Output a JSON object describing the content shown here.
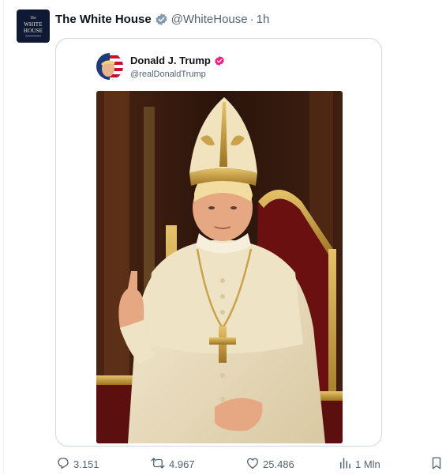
{
  "post": {
    "author_name": "The White House",
    "author_handle": "@WhiteHouse",
    "separator": "·",
    "time": "1h",
    "avatar_text": {
      "the": "The",
      "line1": "WHITE",
      "line2": "HOUSE"
    }
  },
  "quoted": {
    "author_name": "Donald J. Trump",
    "author_handle": "@realDonaldTrump"
  },
  "actions": {
    "replies": "3.151",
    "reposts": "4.967",
    "likes": "25.486",
    "views": "1 Mln"
  },
  "icons": {
    "verified": "verified-badge-icon",
    "reply": "reply-icon",
    "repost": "repost-icon",
    "like": "heart-icon",
    "views": "analytics-icon",
    "bookmark": "bookmark-icon"
  },
  "colors": {
    "gov_badge": "#829aab",
    "quoted_badge": "#f91880",
    "muted": "#536471",
    "border": "#cfd9de"
  }
}
